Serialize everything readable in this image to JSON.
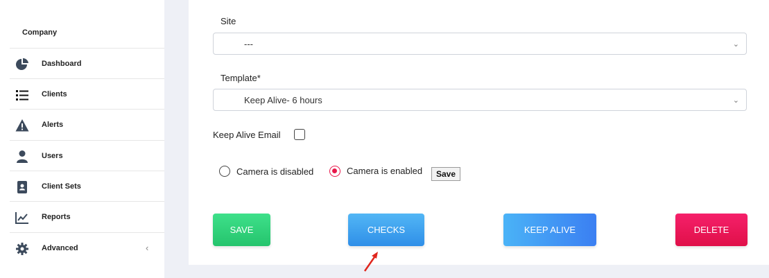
{
  "sidebar": {
    "company": "Company",
    "items": [
      {
        "label": "Dashboard",
        "icon": "pie-chart-icon"
      },
      {
        "label": "Clients",
        "icon": "list-icon"
      },
      {
        "label": "Alerts",
        "icon": "warning-icon"
      },
      {
        "label": "Users",
        "icon": "user-icon"
      },
      {
        "label": "Client Sets",
        "icon": "address-book-icon"
      },
      {
        "label": "Reports",
        "icon": "line-chart-icon"
      },
      {
        "label": "Advanced",
        "icon": "gear-icon"
      }
    ]
  },
  "form": {
    "site_label": "Site",
    "site_value": "---",
    "template_label": "Template*",
    "template_value": "Keep Alive- 6 hours",
    "keep_alive_email_label": "Keep Alive Email",
    "camera_disabled_label": "Camera is disabled",
    "camera_enabled_label": "Camera is enabled",
    "camera_selected": "enabled",
    "camera_save_label": "Save"
  },
  "actions": {
    "save": "SAVE",
    "checks": "CHECKS",
    "keep_alive": "KEEP ALIVE",
    "delete": "DELETE"
  },
  "colors": {
    "save_green": "#2ed47a",
    "checks_blue": "#3ea0f0",
    "keep_alive_blue": "#3d8ff5",
    "delete_pink": "#ec1458",
    "radio_accent": "#e8174a",
    "annotation_red": "#e0261d"
  }
}
